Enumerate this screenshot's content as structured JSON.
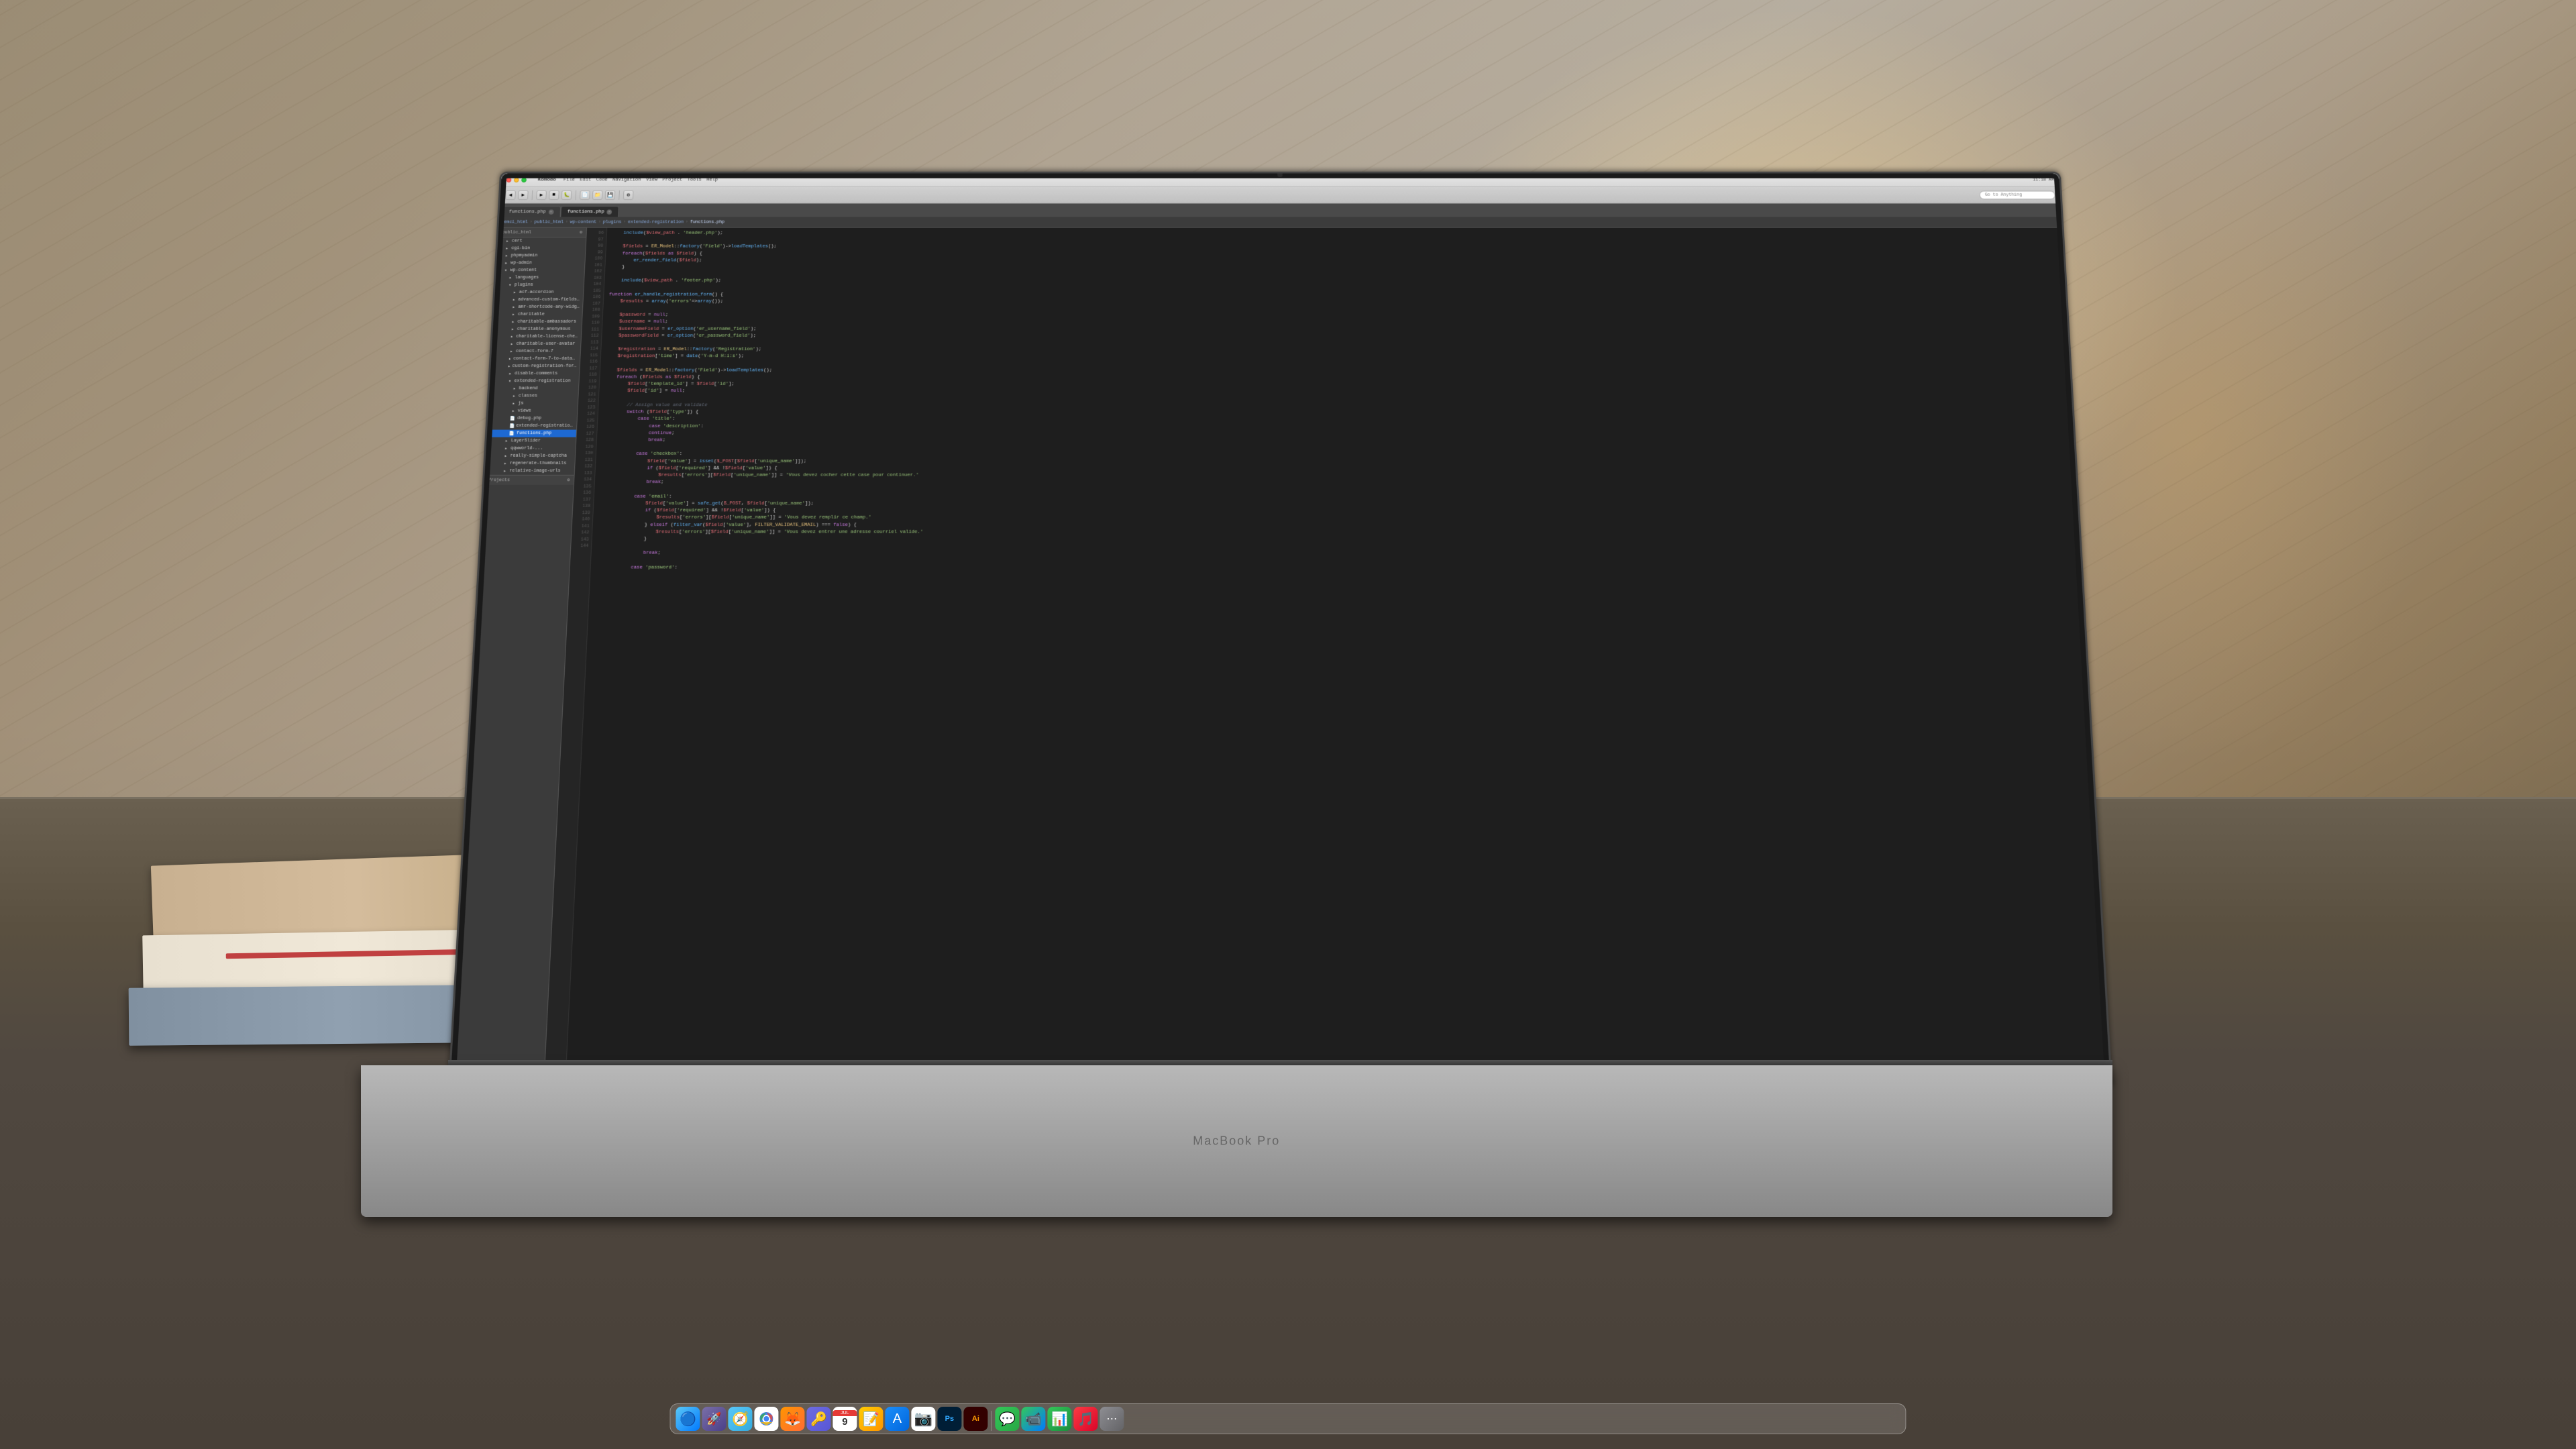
{
  "scene": {
    "laptop_brand": "MacBook Pro",
    "desk_surface": true
  },
  "menubar": {
    "app_name": "Komodo",
    "items": [
      "File",
      "Edit",
      "Code",
      "Navigation",
      "View",
      "Project",
      "Tools",
      "Help"
    ],
    "right_info": "11:18 AM",
    "go_to_anything": "Go to Anything"
  },
  "tabs": [
    {
      "label": "functions.php",
      "active": false
    },
    {
      "label": "functions.php",
      "active": true
    }
  ],
  "breadcrumb": {
    "items": [
      "emci_html",
      "public_html",
      "wp-content",
      "plugins",
      "extended-registration",
      "functions.php"
    ]
  },
  "file_tree": {
    "header": "public_html",
    "items": [
      {
        "label": "cert",
        "indent": 1,
        "type": "folder",
        "expanded": false
      },
      {
        "label": "cgi-bin",
        "indent": 1,
        "type": "folder",
        "expanded": false
      },
      {
        "label": "phpmyadmin",
        "indent": 1,
        "type": "folder",
        "expanded": false
      },
      {
        "label": "wp-admin",
        "indent": 1,
        "type": "folder",
        "expanded": false
      },
      {
        "label": "wp-content",
        "indent": 1,
        "type": "folder",
        "expanded": true
      },
      {
        "label": "languages",
        "indent": 2,
        "type": "folder",
        "expanded": false
      },
      {
        "label": "plugins",
        "indent": 2,
        "type": "folder",
        "expanded": true
      },
      {
        "label": "acf-accordion",
        "indent": 3,
        "type": "folder",
        "expanded": false
      },
      {
        "label": "advanced-custom-fields-pro",
        "indent": 3,
        "type": "folder",
        "expanded": false
      },
      {
        "label": "amr-shortcode-any-widget",
        "indent": 3,
        "type": "folder",
        "expanded": false
      },
      {
        "label": "charitable",
        "indent": 3,
        "type": "folder",
        "expanded": false
      },
      {
        "label": "charitable-ambassadors",
        "indent": 3,
        "type": "folder",
        "expanded": false
      },
      {
        "label": "charitable-anonymous",
        "indent": 3,
        "type": "folder",
        "expanded": false
      },
      {
        "label": "charitable-license-checker",
        "indent": 3,
        "type": "folder",
        "expanded": false
      },
      {
        "label": "charitable-user-avatar",
        "indent": 3,
        "type": "folder",
        "expanded": false
      },
      {
        "label": "contact-form-7",
        "indent": 3,
        "type": "folder",
        "expanded": false
      },
      {
        "label": "contact-form-7-to-database-extension",
        "indent": 3,
        "type": "folder",
        "expanded": false
      },
      {
        "label": "custom-registration-form-builder-with-submit",
        "indent": 3,
        "type": "folder",
        "expanded": false
      },
      {
        "label": "disable-comments",
        "indent": 3,
        "type": "folder",
        "expanded": false
      },
      {
        "label": "extended-registration",
        "indent": 3,
        "type": "folder",
        "expanded": true
      },
      {
        "label": "backend",
        "indent": 4,
        "type": "folder",
        "expanded": false
      },
      {
        "label": "classes",
        "indent": 4,
        "type": "folder",
        "expanded": false
      },
      {
        "label": "js",
        "indent": 4,
        "type": "folder",
        "expanded": false
      },
      {
        "label": "views",
        "indent": 4,
        "type": "folder",
        "expanded": false
      },
      {
        "label": "debug.php",
        "indent": 4,
        "type": "file"
      },
      {
        "label": "extended-registration.php",
        "indent": 4,
        "type": "file"
      },
      {
        "label": "functions.php",
        "indent": 4,
        "type": "file",
        "selected": true
      },
      {
        "label": "LayerSlider",
        "indent": 3,
        "type": "folder",
        "expanded": false
      },
      {
        "label": "qqwworld-...",
        "indent": 3,
        "type": "folder",
        "expanded": false
      },
      {
        "label": "really-simple-captcha",
        "indent": 3,
        "type": "folder",
        "expanded": false
      },
      {
        "label": "regenerate-thumbnails",
        "indent": 3,
        "type": "folder",
        "expanded": false
      },
      {
        "label": "relative-image-urls",
        "indent": 3,
        "type": "folder",
        "expanded": false
      }
    ],
    "projects_section": "Projects"
  },
  "code": {
    "lines": [
      {
        "num": "96",
        "content": "    include($view_path . 'header.php');"
      },
      {
        "num": "97",
        "content": ""
      },
      {
        "num": "98",
        "content": "    $fields = ER_Model::factory('Field')->loadTemplates();"
      },
      {
        "num": "99",
        "content": "    foreach($fields as $field) {"
      },
      {
        "num": "100",
        "content": "        er_render_field($field);"
      },
      {
        "num": "101",
        "content": "    }"
      },
      {
        "num": "102",
        "content": ""
      },
      {
        "num": "103",
        "content": "    include($view_path . 'footer.php');"
      },
      {
        "num": "104",
        "content": ""
      },
      {
        "num": "105",
        "content": "function er_handle_registration_form() {"
      },
      {
        "num": "106",
        "content": "    $results = array('errors'=>array());"
      },
      {
        "num": "107",
        "content": ""
      },
      {
        "num": "108",
        "content": "    $password = null;"
      },
      {
        "num": "109",
        "content": "    $username = null;"
      },
      {
        "num": "110",
        "content": "    $usernameField = er_option('er_username_field');"
      },
      {
        "num": "111",
        "content": "    $passwordField = er_option('er_password_field');"
      },
      {
        "num": "112",
        "content": ""
      },
      {
        "num": "113",
        "content": "    $registration = ER_Model::factory('Registration');"
      },
      {
        "num": "114",
        "content": "    $registration['time'] = date('Y-m-d H:i:s');"
      },
      {
        "num": "115",
        "content": ""
      },
      {
        "num": "116",
        "content": "    $fields = ER_Model::factory('Field')->loadTemplates();"
      },
      {
        "num": "117",
        "content": "    foreach ($fields as $field) {"
      },
      {
        "num": "118",
        "content": "        $field['template_id'] = $field['id'];"
      },
      {
        "num": "119",
        "content": "        $field['id'] = null;"
      },
      {
        "num": "120",
        "content": "        "
      },
      {
        "num": "121",
        "content": "        // Assign value and validate"
      },
      {
        "num": "122",
        "content": "        switch ($field['type']) {"
      },
      {
        "num": "123",
        "content": "            case 'title':"
      },
      {
        "num": "124",
        "content": "                case 'description':"
      },
      {
        "num": "125",
        "content": "                continue;"
      },
      {
        "num": "126",
        "content": "                break;"
      },
      {
        "num": "127",
        "content": ""
      },
      {
        "num": "128",
        "content": "            case 'checkbox':"
      },
      {
        "num": "129",
        "content": "                $field['value'] = isset($_POST[$field['unique_name']]);"
      },
      {
        "num": "130",
        "content": "                if ($field['required'] && !$field['value']) {"
      },
      {
        "num": "131",
        "content": "                    $results['errors'][$field['unique_name']] = 'Vous devez cocher cette case pour continuer.'"
      },
      {
        "num": "132",
        "content": "                break;"
      },
      {
        "num": "133",
        "content": ""
      },
      {
        "num": "134",
        "content": "            case 'email':"
      },
      {
        "num": "135",
        "content": "                $field['value'] = safe_get($_POST, $field['unique_name']);"
      },
      {
        "num": "136",
        "content": "                if ($field['required'] && !$field['value']) {"
      },
      {
        "num": "137",
        "content": "                    $results['errors'][$field['unique_name']] = 'Vous devez remplir ce champ.'"
      },
      {
        "num": "138",
        "content": "                } elseif (filter_var($field['value'], FILTER_VALIDATE_EMAIL) === false) {"
      },
      {
        "num": "139",
        "content": "                    $results['errors'][$field['unique_name']] = 'Vous devez entrer une adresse courriel valide.'"
      },
      {
        "num": "140",
        "content": "                }"
      },
      {
        "num": "141",
        "content": ""
      },
      {
        "num": "142",
        "content": "                break;"
      },
      {
        "num": "143",
        "content": ""
      },
      {
        "num": "144",
        "content": "            case 'password':"
      }
    ]
  },
  "dock": {
    "icons": [
      {
        "name": "finder",
        "label": "Finder",
        "symbol": "🔵",
        "class": "dock-finder"
      },
      {
        "name": "launchpad",
        "label": "Launchpad",
        "symbol": "🚀",
        "class": "dock-launchpad"
      },
      {
        "name": "safari",
        "label": "Safari",
        "symbol": "🧭",
        "class": "dock-safari"
      },
      {
        "name": "chrome",
        "label": "Google Chrome",
        "symbol": "⚪",
        "class": "dock-chrome"
      },
      {
        "name": "firefox",
        "label": "Firefox",
        "symbol": "🦊",
        "class": "dock-firefox"
      },
      {
        "name": "keychain",
        "label": "Keychain Access",
        "symbol": "🔑",
        "class": "dock-keychain"
      },
      {
        "name": "calendar",
        "label": "Calendar",
        "symbol": "📅",
        "class": "dock-calendar"
      },
      {
        "name": "notes",
        "label": "Notes",
        "symbol": "📝",
        "class": "dock-notes"
      },
      {
        "name": "app-store",
        "label": "App Store",
        "symbol": "A",
        "class": "dock-appstore"
      },
      {
        "name": "photos",
        "label": "Photos",
        "symbol": "📷",
        "class": "dock-photos"
      },
      {
        "name": "photoshop",
        "label": "Photoshop",
        "symbol": "Ps",
        "class": "dock-photoshop"
      },
      {
        "name": "illustrator",
        "label": "Illustrator",
        "symbol": "Ai",
        "class": "dock-illustrator"
      },
      {
        "name": "messages",
        "label": "Messages",
        "symbol": "💬",
        "class": "dock-messages"
      },
      {
        "name": "facetime",
        "label": "FaceTime",
        "symbol": "📹",
        "class": "dock-facetime"
      },
      {
        "name": "numbers",
        "label": "Numbers",
        "symbol": "📊",
        "class": "dock-numbers"
      },
      {
        "name": "itunes",
        "label": "iTunes",
        "symbol": "🎵",
        "class": "dock-itunes"
      },
      {
        "name": "more",
        "label": "More",
        "symbol": "⋯",
        "class": "dock-more"
      }
    ]
  }
}
